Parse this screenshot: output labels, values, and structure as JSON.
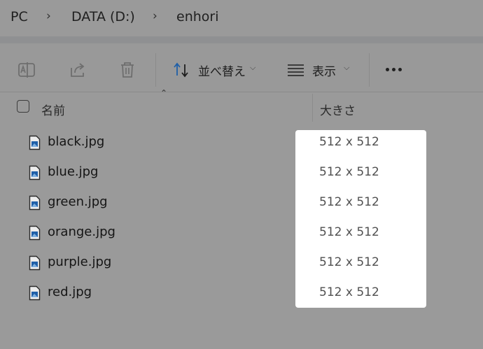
{
  "breadcrumb": {
    "items": [
      "PC",
      "DATA (D:)",
      "enhori"
    ]
  },
  "toolbar": {
    "sort_label": "並べ替え",
    "view_label": "表示"
  },
  "columns": {
    "name": "名前",
    "size": "大きさ"
  },
  "files": [
    {
      "name": "black.jpg",
      "dimensions": "512 x 512"
    },
    {
      "name": "blue.jpg",
      "dimensions": "512 x 512"
    },
    {
      "name": "green.jpg",
      "dimensions": "512 x 512"
    },
    {
      "name": "orange.jpg",
      "dimensions": "512 x 512"
    },
    {
      "name": "purple.jpg",
      "dimensions": "512 x 512"
    },
    {
      "name": "red.jpg",
      "dimensions": "512 x 512"
    }
  ],
  "colors": {
    "overlay": "#9a9a9a",
    "highlight": "#ffffff",
    "accent": "#1f5fa8"
  },
  "icons": [
    "rename-icon",
    "share-icon",
    "delete-icon",
    "sort-icon",
    "view-icon",
    "more-icon",
    "image-file-icon"
  ]
}
